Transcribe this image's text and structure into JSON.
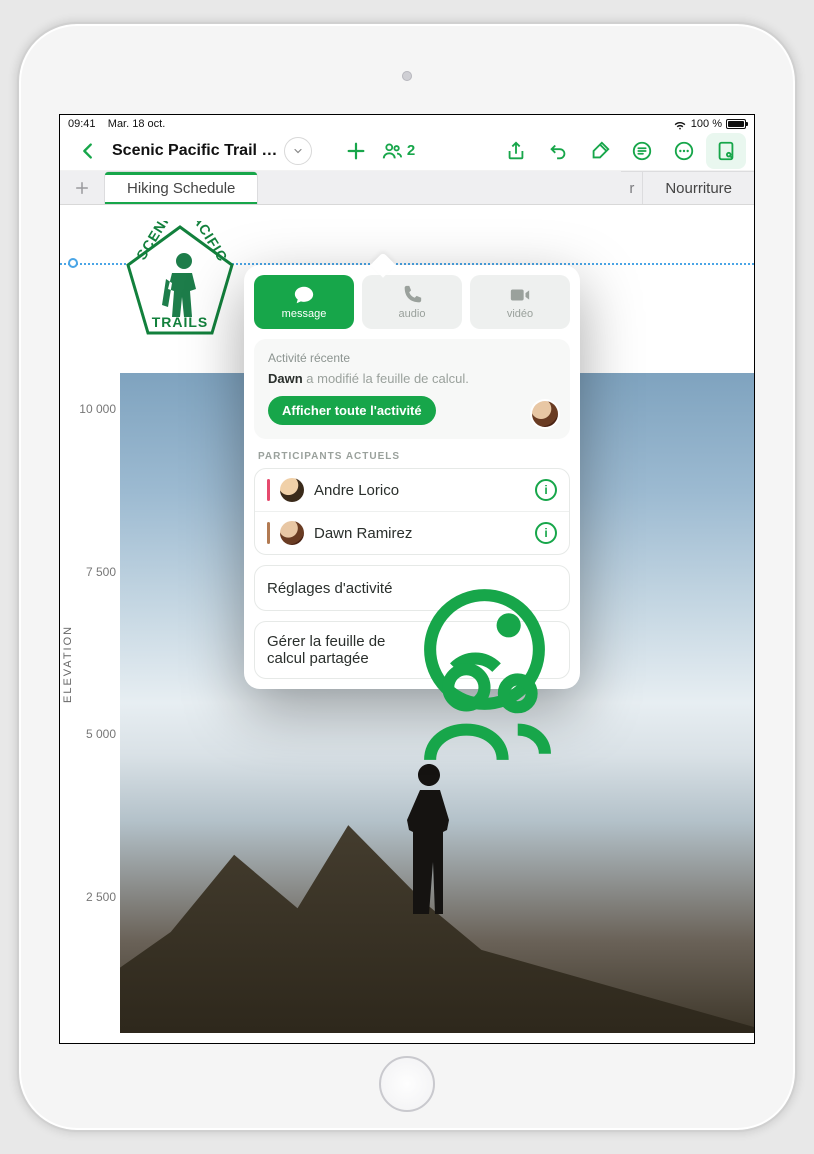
{
  "status": {
    "time": "09:41",
    "date": "Mar. 18 oct.",
    "battery_pct": "100 %"
  },
  "document": {
    "title": "Scenic Pacific Trail Se...",
    "collab_count": "2"
  },
  "tabs": {
    "active": "Hiking Schedule",
    "truncated1": "r",
    "last": "Nourriture"
  },
  "popover": {
    "comm": {
      "message": "message",
      "audio": "audio",
      "video": "vidéo"
    },
    "activity": {
      "title": "Activité récente",
      "actor": "Dawn",
      "text": " a modifié la feuille de calcul.",
      "show_all": "Afficher toute l'activité"
    },
    "participants_label": "PARTICIPANTS ACTUELS",
    "participants": [
      {
        "name": "Andre Lorico",
        "color": "#e64a6e"
      },
      {
        "name": "Dawn Ramirez",
        "color": "#b27a52"
      }
    ],
    "settings_activity": "Réglages d'activité",
    "manage_shared": "Gérer la feuille de calcul partagée"
  },
  "chart_data": {
    "type": "line",
    "title": "",
    "xlabel": "",
    "ylabel": "ELEVATION",
    "ylim": [
      0,
      10000
    ],
    "y_ticks": [
      2500,
      5000,
      7500,
      10000
    ],
    "y_tick_labels": [
      "2 500",
      "5 000",
      "7 500",
      "10 000"
    ]
  },
  "logo": {
    "top": "SCENIC",
    "right": "PACIFIC",
    "bottom": "TRAILS"
  }
}
